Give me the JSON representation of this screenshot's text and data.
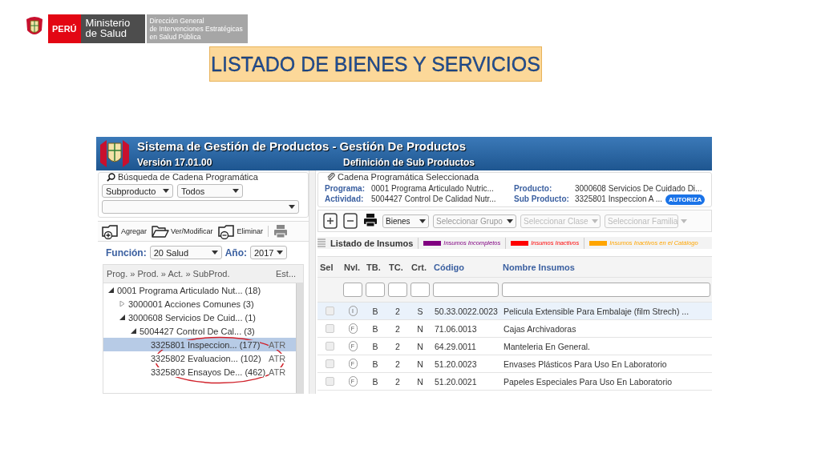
{
  "slide_header": {
    "country": "PERÚ",
    "ministry": "Ministerio de Salud",
    "office_lines": [
      "Dirección General",
      "de Intervenciones Estratégicas",
      "en Salud Pública"
    ]
  },
  "slide_title": "LISTADO DE BIENES Y SERVICIOS",
  "window": {
    "title": "Sistema de Gestión de Productos - Gestión De Productos",
    "version": "Versión 17.01.00",
    "subtitle": "Definición de Sub Productos"
  },
  "search_panel": {
    "legend": "Búsqueda de Cadena Programática",
    "filters": [
      {
        "value": "Subproducto"
      },
      {
        "value": "Todos"
      }
    ]
  },
  "left_toolbar": [
    {
      "kind": "add",
      "label": "Agregar"
    },
    {
      "kind": "open",
      "label": "Ver/Modificar"
    },
    {
      "kind": "remove",
      "label": "Eliminar"
    },
    {
      "kind": "print"
    }
  ],
  "function_row": {
    "function_label": "Función:",
    "function_value": "20 Salud",
    "year_label": "Año:",
    "year_value": "2017"
  },
  "tree": {
    "columns": [
      "Prog. » Prod. » Act. » SubProd.",
      "Est..."
    ],
    "items": [
      {
        "label": "0001 Programa Articulado Nut... (18)",
        "expanded": true,
        "selected": false,
        "children": [
          {
            "label": "3000001 Acciones Comunes (3)",
            "expanded": false,
            "selected": false
          },
          {
            "label": "3000608 Servicios De Cuid... (1)",
            "expanded": true,
            "selected": false,
            "children": [
              {
                "label": "5004427 Control De Cal... (3)",
                "expanded": true,
                "selected": false,
                "children": [
                  {
                    "label": "3325801 Inspeccion... (177)",
                    "status": "ATR",
                    "selected": true
                  },
                  {
                    "label": "3325802 Evaluacion... (102)",
                    "status": "ATR",
                    "selected": false
                  },
                  {
                    "label": "3325803 Ensayos De... (462)",
                    "status": "ATR",
                    "selected": false
                  }
                ]
              }
            ]
          }
        ]
      }
    ]
  },
  "selected_chain": {
    "legend": "Cadena Programática Seleccionada",
    "fields": [
      {
        "label": "Programa:",
        "value": "0001 Programa Articulado Nutric..."
      },
      {
        "label": "Producto:",
        "value": "3000608 Servicios De Cuidado Di..."
      },
      {
        "label": "Actividad:",
        "value": "5004427 Control De Calidad Nutr..."
      },
      {
        "label": "Sub Producto:",
        "value": "3325801 Inspeccion A ...",
        "badge": "AUTORIZA"
      }
    ]
  },
  "right_toolbar": {
    "buttons": [
      {
        "kind": "add"
      },
      {
        "kind": "remove"
      },
      {
        "kind": "print"
      }
    ],
    "selects": [
      {
        "value": "Bienes",
        "disabled": false
      },
      {
        "placeholder": "Seleccionar Grupo",
        "disabled": false
      },
      {
        "placeholder": "Seleccionar Clase",
        "disabled": true
      },
      {
        "placeholder": "Seleccionar Familia",
        "disabled": true
      }
    ]
  },
  "insumos": {
    "title": "Listado de Insumos",
    "legend": [
      {
        "label": "Insumos Incompletos",
        "color": "#800080"
      },
      {
        "label": "Insumos Inactivos",
        "color": "#ff0000"
      },
      {
        "label": "Insumos Inactivos en el Catálogo",
        "color": "#ffa500"
      }
    ],
    "select_column": "Sel",
    "columns": [
      "Nvl.",
      "TB.",
      "TC.",
      "Crt.",
      "Código",
      "Nombre Insumos"
    ],
    "rows": [
      {
        "checked": false,
        "selected": true,
        "cells": [
          "I",
          "B",
          "2",
          "S",
          "50.33.0022.0023",
          "Pelicula Extensible Para Embalaje (film Strech) ..."
        ]
      },
      {
        "checked": false,
        "selected": false,
        "cells": [
          "F",
          "B",
          "2",
          "N",
          "71.06.0013",
          "Cajas Archivadoras"
        ]
      },
      {
        "checked": false,
        "selected": false,
        "cells": [
          "F",
          "B",
          "2",
          "N",
          "64.29.0011",
          "Manteleria En General."
        ]
      },
      {
        "checked": false,
        "selected": false,
        "cells": [
          "F",
          "B",
          "2",
          "N",
          "51.20.0023",
          "Envases Plásticos Para Uso En Laboratorio"
        ]
      },
      {
        "checked": false,
        "selected": false,
        "cells": [
          "F",
          "B",
          "2",
          "N",
          "51.20.0021",
          "Papeles Especiales Para Uso En Laboratorio"
        ]
      }
    ]
  }
}
